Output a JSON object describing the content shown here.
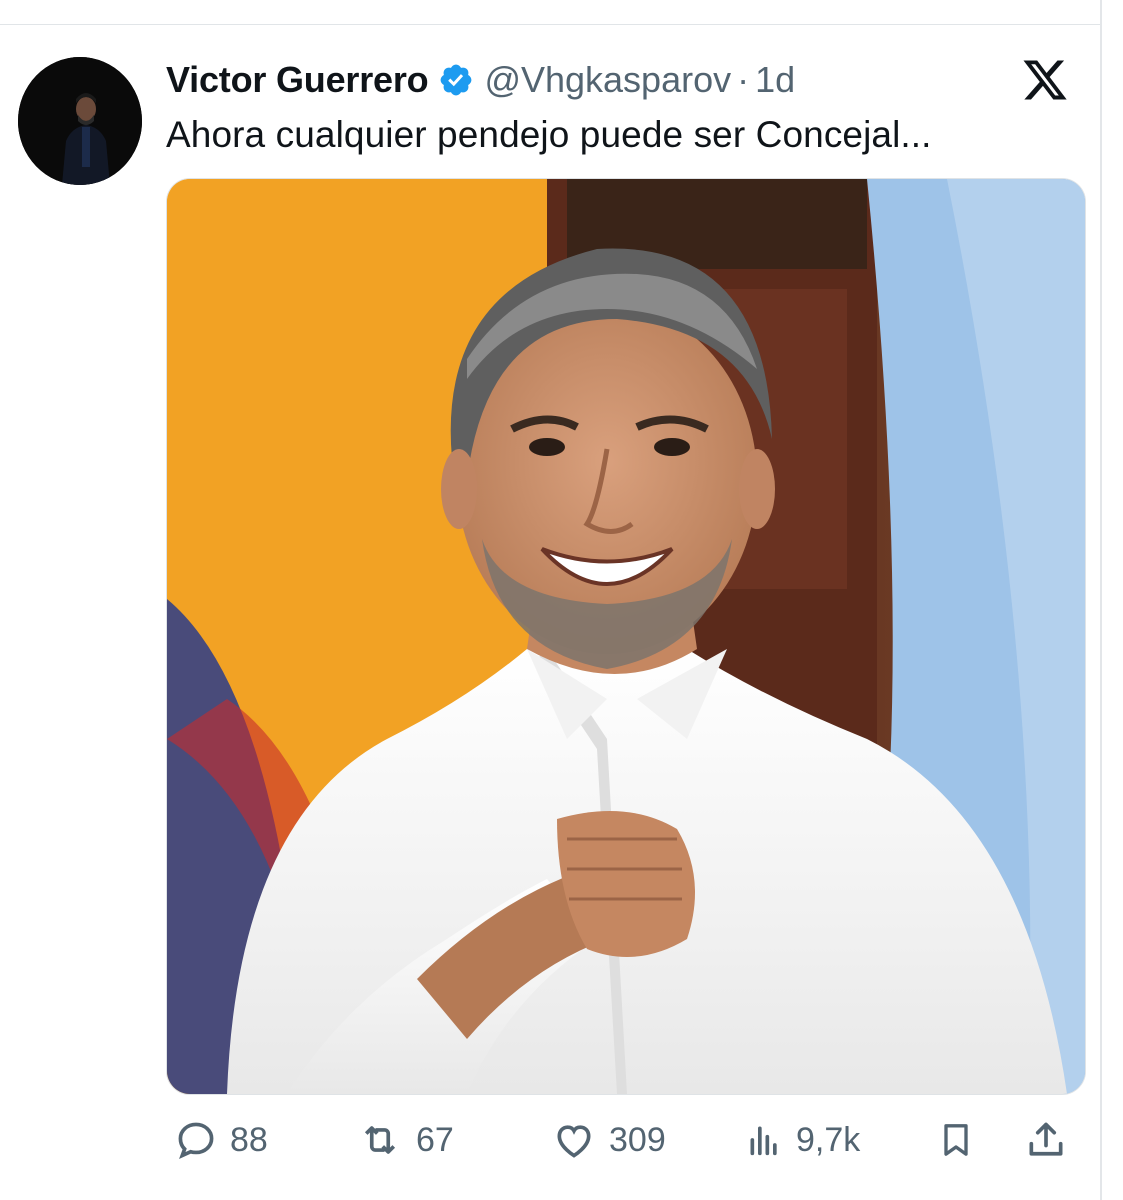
{
  "tweet": {
    "author": {
      "display_name": "Victor Guerrero",
      "verified": true,
      "handle": "@Vhgkasparov",
      "separator": "·",
      "time": "1d"
    },
    "text": "Ahora cualquier pendejo puede ser Concejal...",
    "media": {
      "type": "photo"
    },
    "platform_icon": "x-logo-icon",
    "actions": {
      "replies": "88",
      "reposts": "67",
      "likes": "309",
      "views": "9,7k"
    }
  },
  "colors": {
    "text_primary": "#0f1419",
    "text_secondary": "#536471",
    "verified_blue": "#1d9bf0",
    "border": "#e1e5e8"
  },
  "icons": [
    "reply-icon",
    "repost-icon",
    "like-icon",
    "views-icon",
    "bookmark-icon",
    "share-icon",
    "verified-badge-icon"
  ]
}
